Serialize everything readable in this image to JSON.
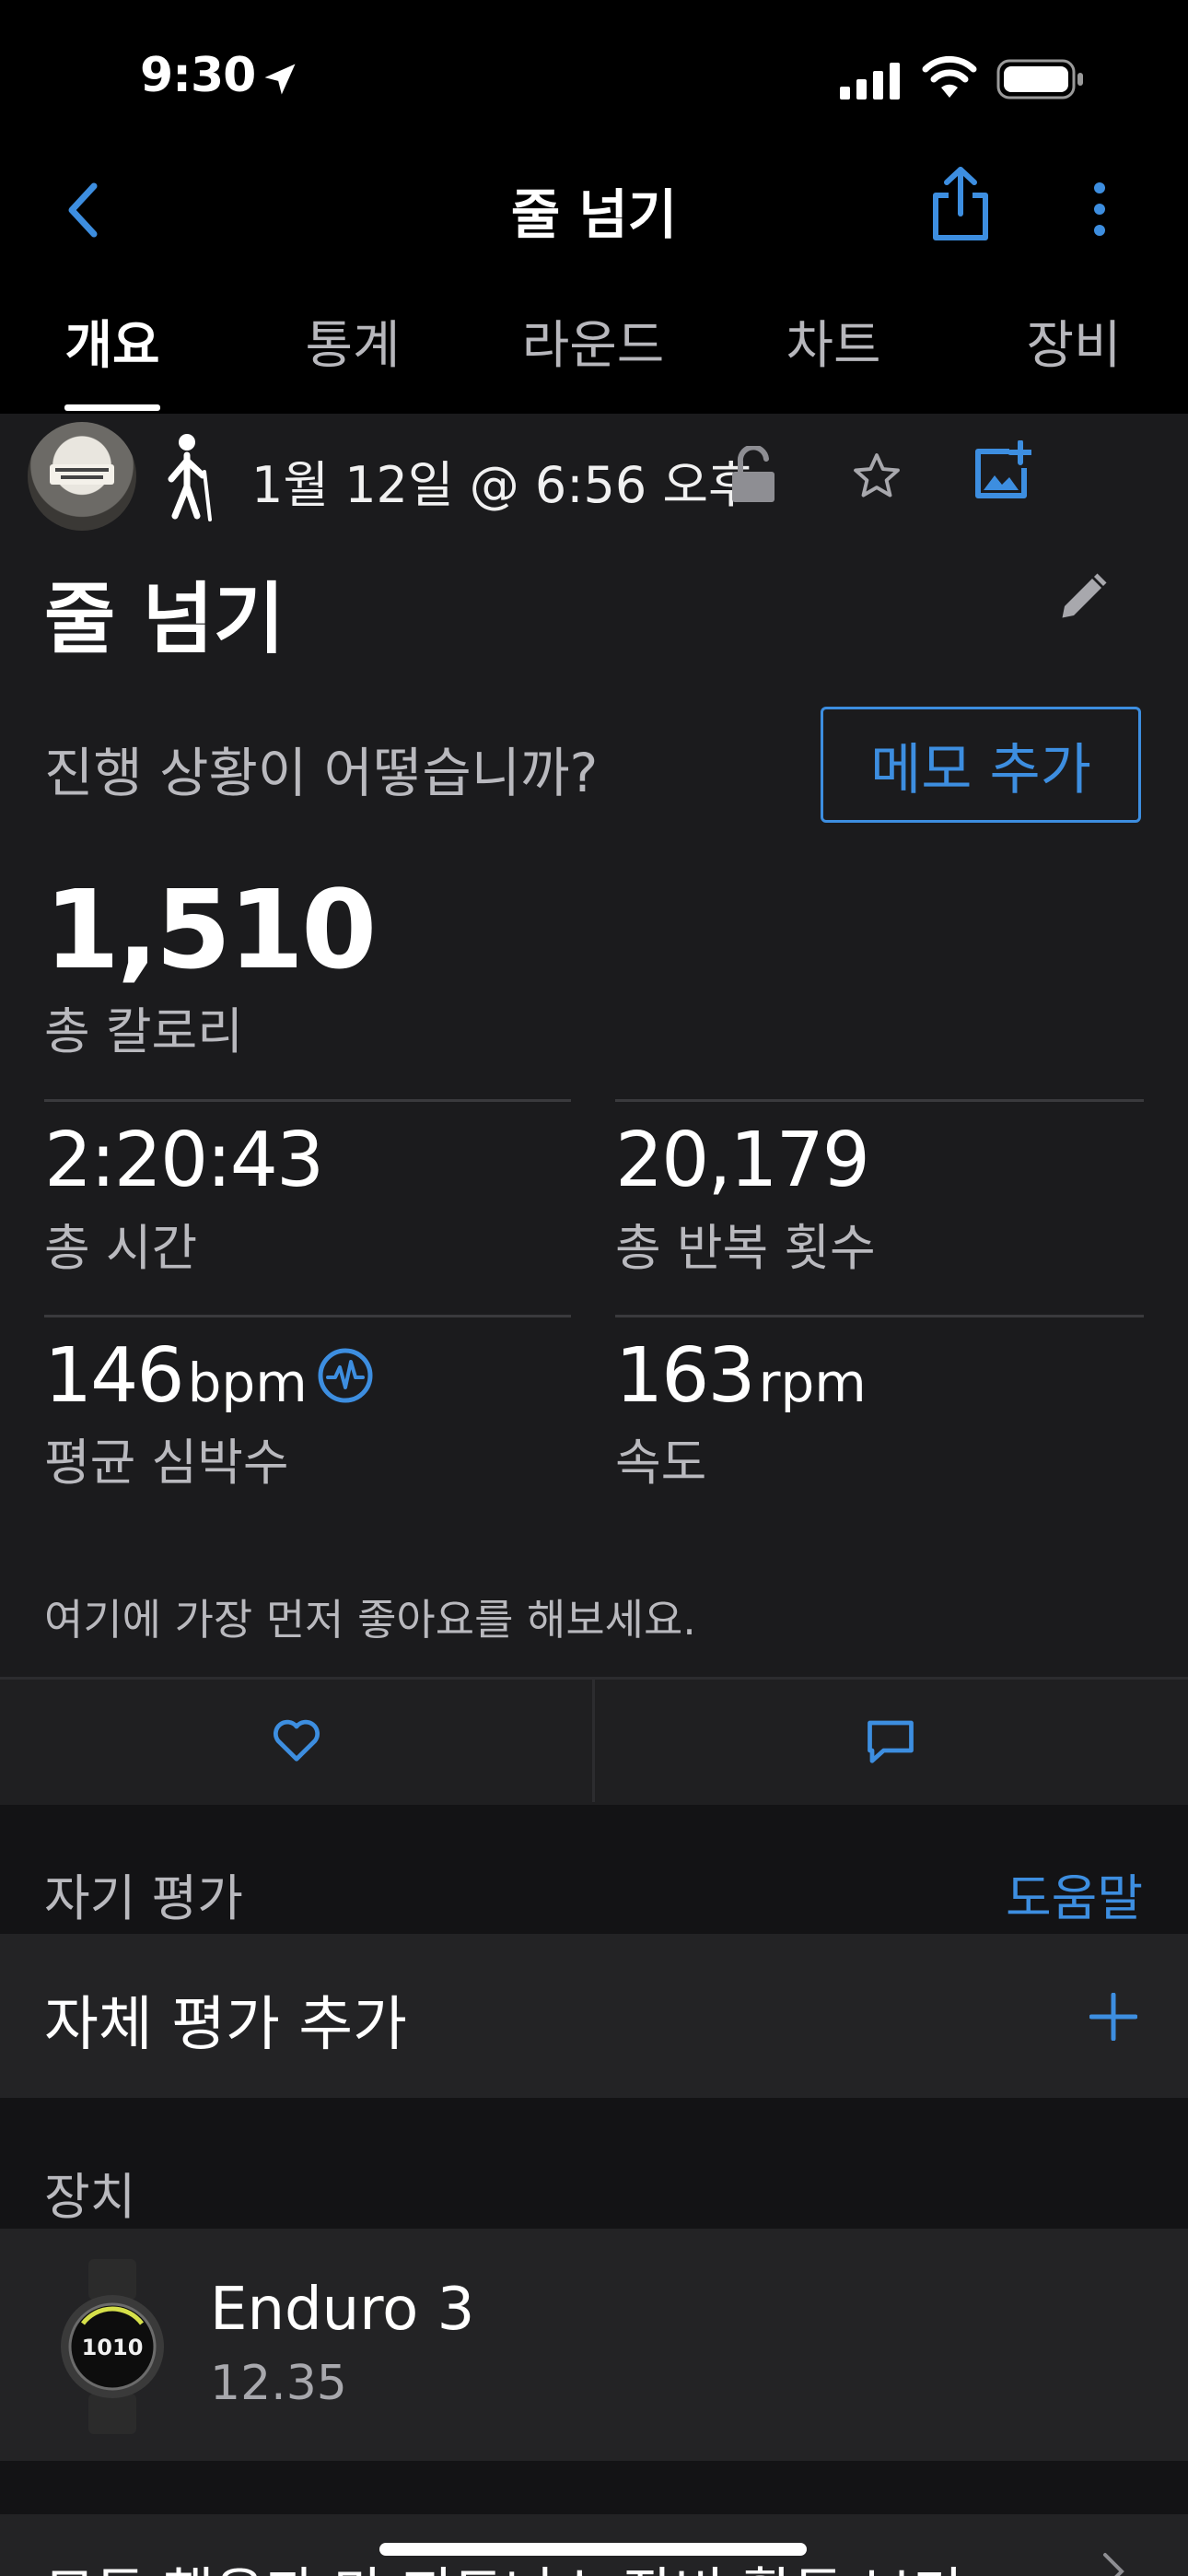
{
  "status": {
    "time": "9:30"
  },
  "nav": {
    "title": "줄 넘기"
  },
  "tabs": [
    {
      "label": "개요"
    },
    {
      "label": "통계"
    },
    {
      "label": "라운드"
    },
    {
      "label": "차트"
    },
    {
      "label": "장비"
    }
  ],
  "header": {
    "date": "1월 12일 @ 6:56 오후"
  },
  "activity": {
    "title": "줄 넘기",
    "prompt": "진행 상황이 어떻습니까?",
    "memo_button": "메모 추가"
  },
  "calories": {
    "value": "1,510",
    "label": "총 칼로리"
  },
  "stats": {
    "time": {
      "value": "2:20:43",
      "label": "총 시간"
    },
    "reps": {
      "value": "20,179",
      "label": "총 반복 횟수"
    },
    "hr": {
      "value": "146",
      "unit": "bpm",
      "label": "평균 심박수"
    },
    "speed": {
      "value": "163",
      "unit": "rpm",
      "label": "속도"
    }
  },
  "kudos": {
    "text": "여기에 가장 먼저 좋아요를 해보세요."
  },
  "self_eval": {
    "section_label": "자기 평가",
    "help_link": "도움말",
    "add_label": "자체 평가 추가"
  },
  "device": {
    "section_label": "장치",
    "name": "Enduro 3",
    "version": "12.35",
    "watch_face_text": "1010"
  },
  "footer_link": {
    "label": "모든 행운과 마 피트니스 장비 활동 보기"
  },
  "colors": {
    "accent": "#3d8ee0",
    "background": "#1b1b1d",
    "topbar": "#000000"
  }
}
